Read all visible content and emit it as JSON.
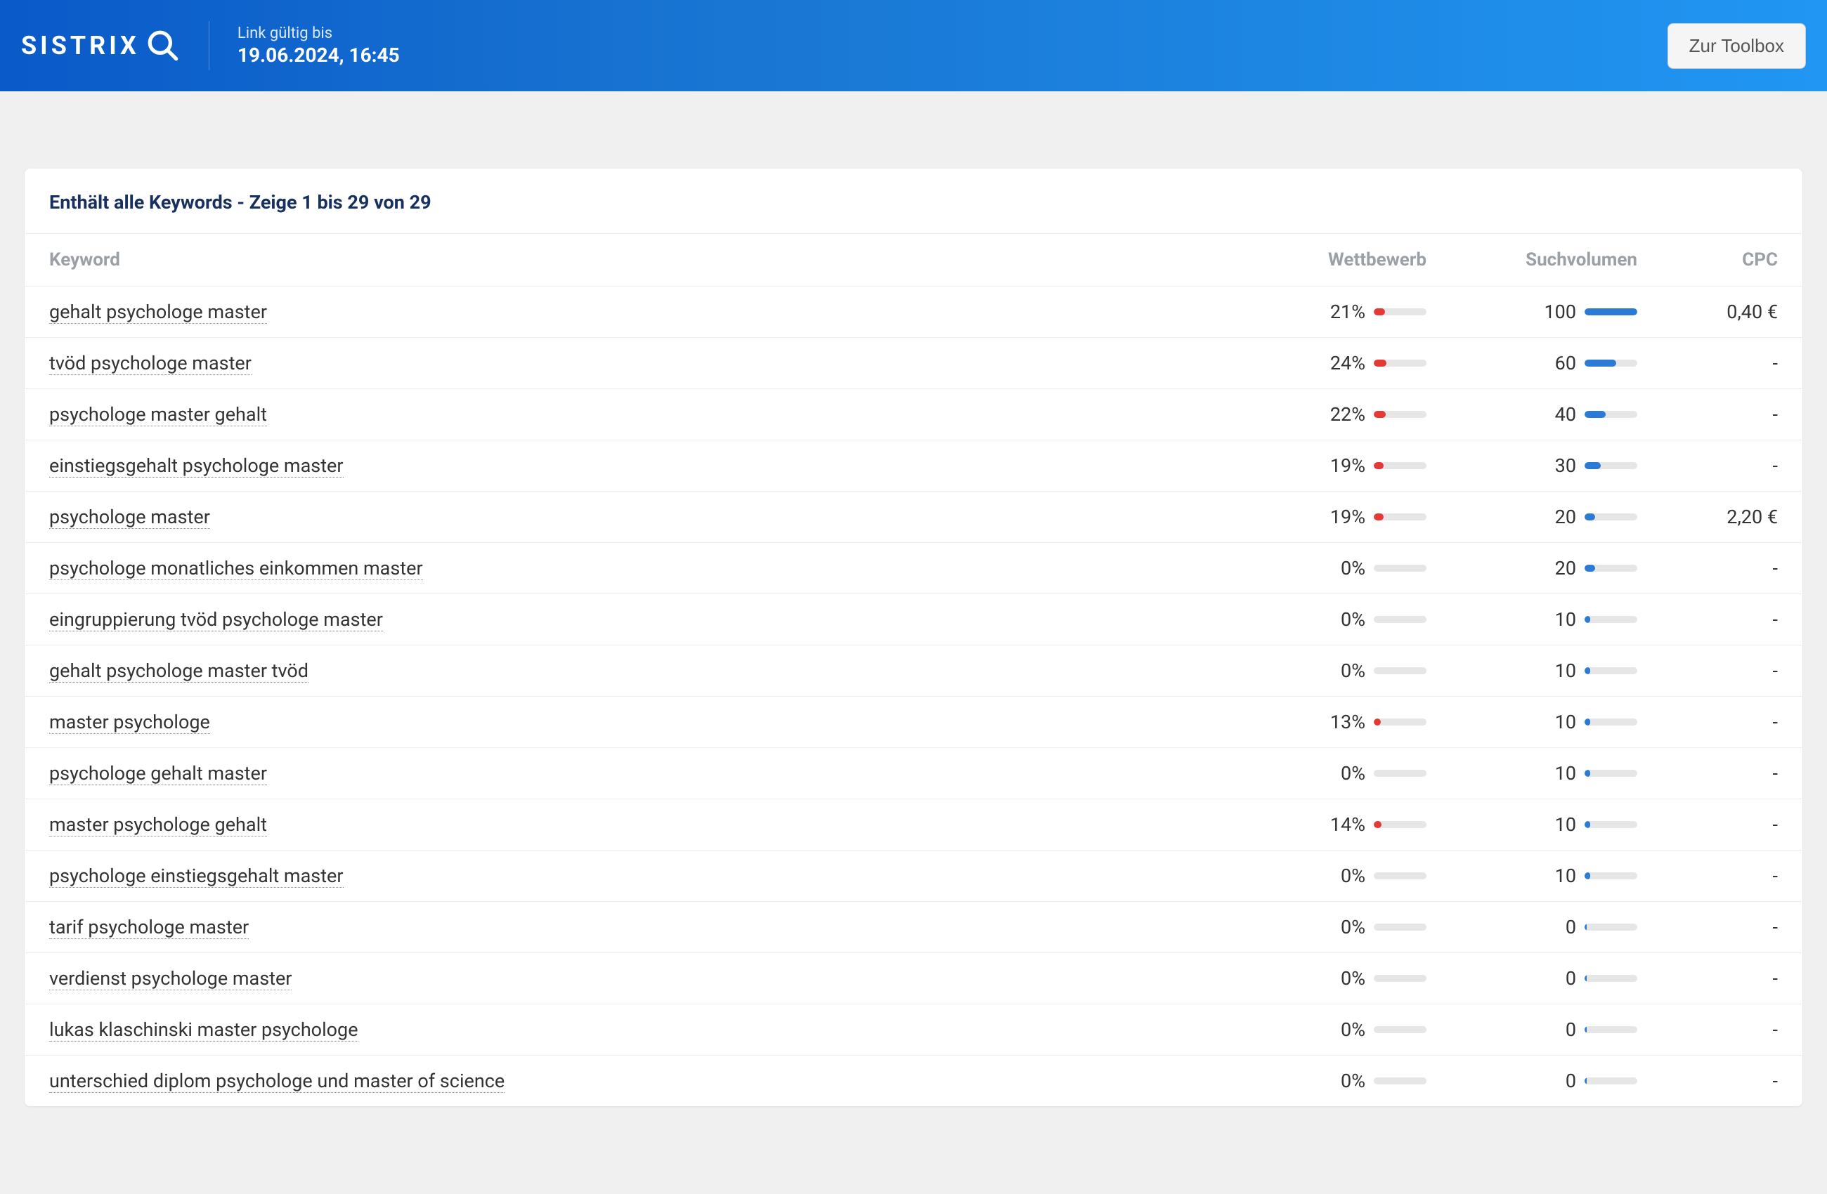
{
  "header": {
    "brand": "SISTRIX",
    "link_label": "Link gültig bis",
    "link_value": "19.06.2024, 16:45",
    "toolbox_button": "Zur Toolbox"
  },
  "card": {
    "title": "Enthält alle Keywords - Zeige 1 bis 29 von 29"
  },
  "columns": {
    "keyword": "Keyword",
    "competition": "Wettbewerb",
    "volume": "Suchvolumen",
    "cpc": "CPC"
  },
  "max_volume": 100,
  "rows": [
    {
      "keyword": "gehalt psychologe master",
      "competition": 21,
      "volume": 100,
      "cpc": "0,40 €"
    },
    {
      "keyword": "tvöd psychologe master",
      "competition": 24,
      "volume": 60,
      "cpc": "-"
    },
    {
      "keyword": "psychologe master gehalt",
      "competition": 22,
      "volume": 40,
      "cpc": "-"
    },
    {
      "keyword": "einstiegsgehalt psychologe master",
      "competition": 19,
      "volume": 30,
      "cpc": "-"
    },
    {
      "keyword": "psychologe master",
      "competition": 19,
      "volume": 20,
      "cpc": "2,20 €"
    },
    {
      "keyword": "psychologe monatliches einkommen master",
      "competition": 0,
      "volume": 20,
      "cpc": "-"
    },
    {
      "keyword": "eingruppierung tvöd psychologe master",
      "competition": 0,
      "volume": 10,
      "cpc": "-"
    },
    {
      "keyword": "gehalt psychologe master tvöd",
      "competition": 0,
      "volume": 10,
      "cpc": "-"
    },
    {
      "keyword": "master psychologe",
      "competition": 13,
      "volume": 10,
      "cpc": "-"
    },
    {
      "keyword": "psychologe gehalt master",
      "competition": 0,
      "volume": 10,
      "cpc": "-"
    },
    {
      "keyword": "master psychologe gehalt",
      "competition": 14,
      "volume": 10,
      "cpc": "-"
    },
    {
      "keyword": "psychologe einstiegsgehalt master",
      "competition": 0,
      "volume": 10,
      "cpc": "-"
    },
    {
      "keyword": "tarif psychologe master",
      "competition": 0,
      "volume": 0,
      "cpc": "-"
    },
    {
      "keyword": "verdienst psychologe master",
      "competition": 0,
      "volume": 0,
      "cpc": "-"
    },
    {
      "keyword": "lukas klaschinski master psychologe",
      "competition": 0,
      "volume": 0,
      "cpc": "-"
    },
    {
      "keyword": "unterschied diplom psychologe und master of science",
      "competition": 0,
      "volume": 0,
      "cpc": "-"
    }
  ]
}
